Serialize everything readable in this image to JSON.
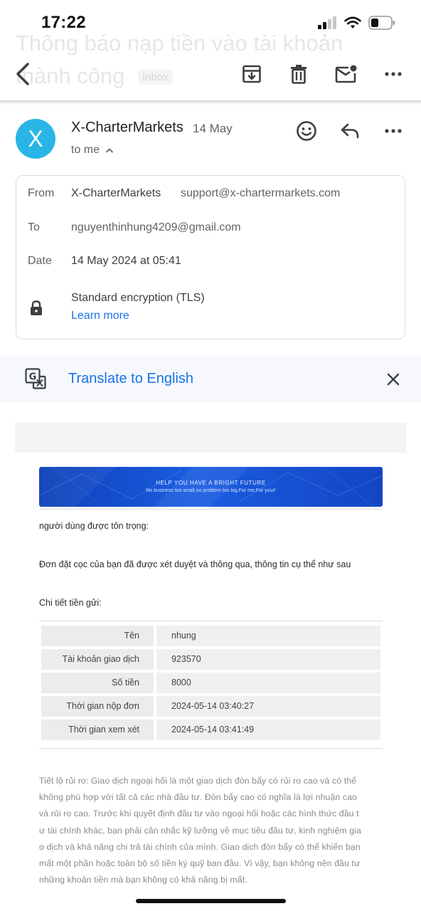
{
  "status_bar": {
    "time": "17:22"
  },
  "header": {
    "subject": "Thông báo nạp tiền vào tài khoản thành công",
    "label": "Inbox"
  },
  "toolbar": {
    "icons": [
      "back-arrow-icon",
      "archive-icon",
      "trash-icon",
      "mark-unread-icon",
      "more-icon"
    ]
  },
  "message": {
    "sender_initial": "X",
    "sender_name": "X-CharterMarkets",
    "date_short": "14 May",
    "to_summary": "to me",
    "avatar_color": "#29b6e6"
  },
  "details": {
    "from_label": "From",
    "from_name": "X-CharterMarkets",
    "from_email": "support@x-chartermarkets.com",
    "to_label": "To",
    "to_email": "nguyenthinhung4209@gmail.com",
    "date_label": "Date",
    "date_value": "14 May 2024 at 05:41",
    "security_value": "Standard encryption (TLS)",
    "learn_more": "Learn more"
  },
  "translate": {
    "label": "Translate to English"
  },
  "email_body": {
    "banner_title": "HELP YOU HAVE A BRIGHT FUTURE",
    "banner_subtitle": "No business too small,no problem too big,For me,For your!",
    "greeting": "người dùng được tôn trọng:",
    "intro": "Đơn đặt cọc của bạn đã được xét duyệt và thông qua, thông tin cụ thể như sau",
    "details_heading": "Chi tiết tiền gửi:",
    "table": [
      {
        "label": "Tên",
        "value": "nhung"
      },
      {
        "label": "Tài khoản giao dịch",
        "value": "923570"
      },
      {
        "label": "Số tiền",
        "value": "8000"
      },
      {
        "label": "Thời gian nộp đơn",
        "value": "2024-05-14 03:40:27"
      },
      {
        "label": "Thời gian xem xét",
        "value": "2024-05-14 03:41:49"
      }
    ],
    "risk_lines": [
      "Tiết lộ rủi ro: Giao dịch ngoại hối là một giao dịch đòn bẩy có rủi ro cao và có thể",
      "không phù hợp với tất cả các nhà đầu tư. Đòn bẩy cao có nghĩa là lợi nhuận cao",
      "và rủi ro cao. Trước khi quyết định đầu tư vào ngoại hối hoặc các hình thức đầu t",
      "ư tài chính khác, bạn phải cân nhắc kỹ lưỡng về mục tiêu đầu tư, kinh nghiệm gia",
      "o dịch và khả năng chi trả tài chính của mình. Giao dịch đòn bẩy có thể khiến bạn",
      "mất một phần hoặc toàn bộ số tiền ký quỹ ban đầu. Vì vậy, bạn không nên đầu tư",
      "những khoản tiền mà bạn không có khả năng bị mất."
    ]
  },
  "colors": {
    "link_blue": "#1a73e8",
    "translate_bg": "#f6f8fc",
    "banner_blue": "#1b5de0"
  }
}
